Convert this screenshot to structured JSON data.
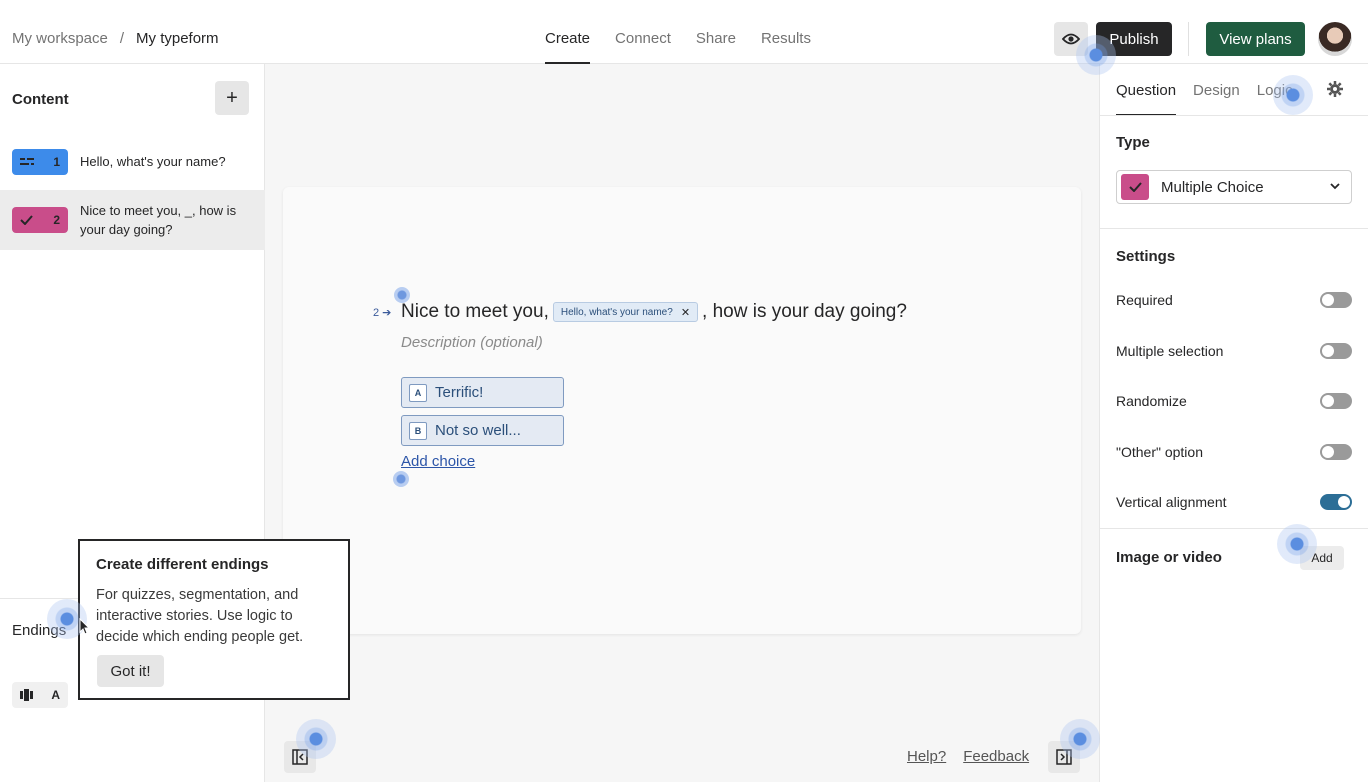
{
  "breadcrumb": {
    "workspace": "My workspace",
    "separator": "/",
    "form": "My typeform"
  },
  "top_tabs": [
    {
      "label": "Create",
      "active": true
    },
    {
      "label": "Connect",
      "active": false
    },
    {
      "label": "Share",
      "active": false
    },
    {
      "label": "Results",
      "active": false
    }
  ],
  "header_actions": {
    "preview_icon": "eye-icon",
    "publish": "Publish",
    "view_plans": "View plans"
  },
  "left_panel": {
    "content_title": "Content",
    "add_icon": "plus-icon",
    "questions": [
      {
        "number": "1",
        "icon": "short-text-icon",
        "text": "Hello, what's your name?",
        "color": "#3d8bea"
      },
      {
        "number": "2",
        "icon": "check-icon",
        "text": "Nice to meet you, _, how is your day going?",
        "color": "#c94d8a"
      }
    ],
    "endings_title": "Endings",
    "ending_badge": {
      "icon": "ending-icon",
      "letter": "A"
    }
  },
  "canvas": {
    "question_number": "2",
    "title_before": "Nice to meet you,",
    "recall_chip": "Hello, what's your name?",
    "title_after": ", how is your day going?",
    "description_placeholder": "Description (optional)",
    "choices": [
      {
        "key": "A",
        "label": "Terrific!"
      },
      {
        "key": "B",
        "label": "Not so well..."
      }
    ],
    "add_choice": "Add choice"
  },
  "footer": {
    "help": "Help?",
    "feedback": "Feedback"
  },
  "right_panel": {
    "tabs": [
      {
        "label": "Question",
        "active": true
      },
      {
        "label": "Design",
        "active": false
      },
      {
        "label": "Logic",
        "active": false
      }
    ],
    "type_label": "Type",
    "type_value": "Multiple Choice",
    "settings_label": "Settings",
    "settings": [
      {
        "label": "Required",
        "on": false
      },
      {
        "label": "Multiple selection",
        "on": false
      },
      {
        "label": "Randomize",
        "on": false
      },
      {
        "label": "\"Other\" option",
        "on": false
      },
      {
        "label": "Vertical alignment",
        "on": true
      }
    ],
    "media_label": "Image or video",
    "media_add": "Add"
  },
  "popover": {
    "title": "Create different endings",
    "body": "For quizzes, segmentation, and interactive stories. Use logic to decide which ending people get.",
    "button": "Got it!"
  },
  "colors": {
    "publish_bg": "#262627",
    "view_plans_bg": "#1f5c40",
    "accent_blue": "#3d8bea",
    "accent_pink": "#c94d8a",
    "toggle_on": "#2c6e96"
  }
}
